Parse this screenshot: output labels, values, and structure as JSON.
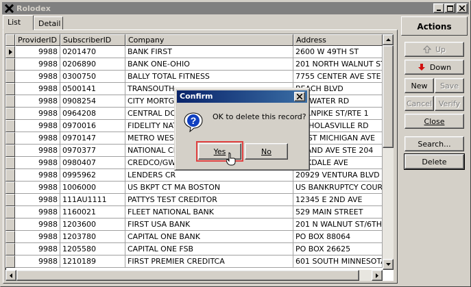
{
  "window": {
    "title": "Rolodex"
  },
  "tabs": [
    {
      "label": "List"
    },
    {
      "label": "Detail"
    }
  ],
  "grid": {
    "columns": [
      "ProviderID",
      "SubscriberID",
      "Company",
      "Address"
    ],
    "rows": [
      [
        "9988",
        "0201470",
        "BANK FIRST",
        "2600 W 49TH ST"
      ],
      [
        "9988",
        "0206890",
        "BANK ONE-OHIO",
        "201 NORTH WALNUT ST"
      ],
      [
        "9988",
        "0300750",
        "BALLY TOTAL FITNESS",
        "7755 CENTER AVE STE 4"
      ],
      [
        "9988",
        "0500141",
        "TRANSOUTH",
        "BEACH BLVD"
      ],
      [
        "9988",
        "0908254",
        "CITY MORTG",
        "ATEWATER RD"
      ],
      [
        "9988",
        "0964208",
        "CENTRAL DO",
        "TURNPIKE ST/RTE 1"
      ],
      [
        "9988",
        "0970016",
        "FIDELITY NAT",
        "NICHOLASVILLE RD"
      ],
      [
        "9988",
        "0970147",
        "METRO WES",
        "WEST MICHIGAN AVE"
      ],
      [
        "9988",
        "0970377",
        "NATIONAL CF",
        "GRAND AVE STE 204"
      ],
      [
        "9988",
        "0980407",
        "CREDCO/GW",
        "OAKDALE AVE"
      ],
      [
        "9988",
        "0995962",
        "LENDERS CR",
        "20929 VENTURA BLVD #"
      ],
      [
        "9988",
        "1006000",
        "US BKPT CT MA BOSTON",
        "US BANKRUPTCY COURT"
      ],
      [
        "9988",
        "111AU1111",
        "PATTYS TEST CREDITOR",
        "12345 E 2ND AVE"
      ],
      [
        "9988",
        "1160021",
        "FLEET NATIONAL BANK",
        "529 MAIN STREET"
      ],
      [
        "9988",
        "1203600",
        "FIRST USA BANK",
        "201 N WALNUT ST/6TH F"
      ],
      [
        "9988",
        "1203780",
        "CAPITAL ONE BANK",
        "PO BOX 88064"
      ],
      [
        "9988",
        "1205580",
        "CAPITAL ONE FSB",
        "PO BOX 26625"
      ],
      [
        "9988",
        "1210189",
        "FIRST PREMIER CREDITCA",
        "601 SOUTH MINNESOTA"
      ]
    ]
  },
  "actions": {
    "title": "Actions",
    "up": "Up",
    "down": "Down",
    "new": "New",
    "save": "Save",
    "cancel": "Cancel",
    "verify": "Verify",
    "close": "Close",
    "search": "Search...",
    "delete": "Delete"
  },
  "dialog": {
    "title": "Confirm",
    "message": "OK to delete this record?",
    "yes": "Yes",
    "no": "No",
    "icon": "question-icon"
  }
}
